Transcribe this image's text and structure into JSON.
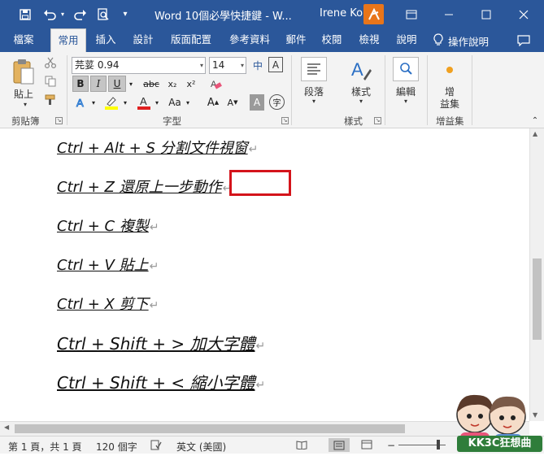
{
  "titlebar": {
    "title": "Word 10個必學快捷鍵 - W...",
    "user": "Irene Ko",
    "save_icon": "save-icon",
    "undo_icon": "undo-icon",
    "redo_icon": "redo-icon",
    "preview_icon": "print-preview-icon",
    "customize_icon": "customize-qat-icon"
  },
  "tabs": [
    "檔案",
    "常用",
    "插入",
    "設計",
    "版面配置",
    "參考資料",
    "郵件",
    "校閱",
    "檢視",
    "說明"
  ],
  "active_tab": "常用",
  "tell_me": "操作說明",
  "ribbon": {
    "clipboard": {
      "paste_label": "貼上",
      "group_label": "剪貼簿"
    },
    "font": {
      "font_name": "芫荽 0.94",
      "font_size": "14",
      "phonetic_label": "中",
      "bold": "B",
      "italic": "I",
      "underline": "U",
      "strike": "abc",
      "subscript": "x₂",
      "superscript": "x²",
      "case_label": "Aa",
      "grow_label": "A",
      "shrink_label": "A",
      "char_shading": "A",
      "enclose_label": "字",
      "group_label": "字型"
    },
    "paragraph": {
      "label": "段落"
    },
    "styles": {
      "label": "樣式",
      "group_label": "樣式"
    },
    "editing": {
      "label": "編輯"
    },
    "addins": {
      "label_line1": "增",
      "label_line2": "益集",
      "group_label": "增益集"
    }
  },
  "document": {
    "lines": [
      "Ctrl + Alt + S 分割文件視窗",
      "Ctrl + Z 還原上一步動作",
      "Ctrl + C 複製",
      "Ctrl + V 貼上",
      "Ctrl + X 剪下",
      "Ctrl + Shift + > 加大字體",
      "Ctrl + Shift + < 縮小字體"
    ],
    "highlight_color": "#d4141b"
  },
  "status": {
    "page": "第 1 頁，共 1 頁",
    "words": "120 個字",
    "language": "英文 (美國)"
  },
  "watermark": {
    "text": "KK3C狂想曲"
  },
  "colors": {
    "accent": "#2b579a",
    "ribbon_bg": "#f3f3f3"
  }
}
